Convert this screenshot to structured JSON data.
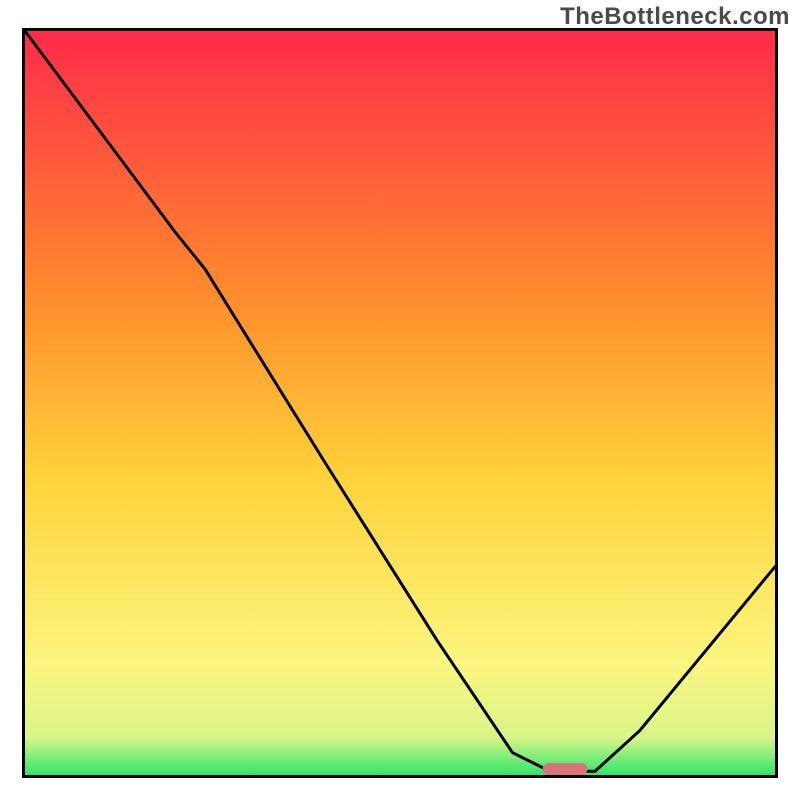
{
  "watermark": "TheBottleneck.com",
  "chart_data": {
    "type": "line",
    "title": "",
    "xlabel": "",
    "ylabel": "",
    "xlim": [
      0,
      100
    ],
    "ylim": [
      0,
      100
    ],
    "grid": false,
    "legend": false,
    "gradient": {
      "top_color": "#ff2b4a",
      "mid_upper_color": "#ff8a2c",
      "mid_color": "#ffd23a",
      "lower_color": "#fbf67f",
      "near_bottom_color": "#d9f58a",
      "bottom_color": "#2ee66b"
    },
    "curve": [
      {
        "x": 0,
        "y": 100
      },
      {
        "x": 20,
        "y": 73
      },
      {
        "x": 24,
        "y": 68
      },
      {
        "x": 40,
        "y": 42
      },
      {
        "x": 55,
        "y": 18
      },
      {
        "x": 65,
        "y": 3
      },
      {
        "x": 70,
        "y": 0.5
      },
      {
        "x": 76,
        "y": 0.5
      },
      {
        "x": 82,
        "y": 6
      },
      {
        "x": 100,
        "y": 28
      }
    ],
    "optimum_marker": {
      "x_center": 72,
      "y": 0.8,
      "width_pct": 6,
      "color": "#d9757a"
    }
  }
}
